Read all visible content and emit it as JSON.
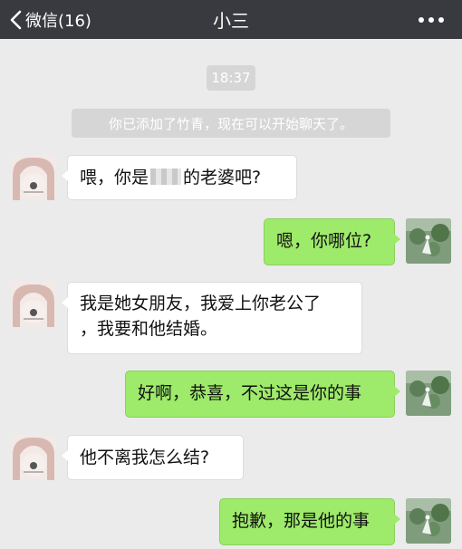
{
  "nav": {
    "back_label": "微信(16)",
    "title": "小三"
  },
  "chat": {
    "time": "18:37",
    "system_message": "你已添加了竹青，现在可以开始聊天了。",
    "messages": [
      {
        "side": "left",
        "text_before": "喂，你是",
        "text_after": "的老婆吧?"
      },
      {
        "side": "right",
        "text": "嗯，你哪位?"
      },
      {
        "side": "left",
        "line1": "我是她女朋友，我爱上你老公了",
        "line2": "，我要和他结婚。"
      },
      {
        "side": "right",
        "text": "好啊，恭喜，不过这是你的事"
      },
      {
        "side": "left",
        "text": "他不离我怎么结?"
      },
      {
        "side": "right",
        "text": "抱歉，那是他的事"
      }
    ]
  },
  "colors": {
    "nav_bg": "#393a3f",
    "chat_bg": "#ebebeb",
    "sent_bubble": "#9eea6a",
    "received_bubble": "#ffffff"
  },
  "icons": {
    "back": "chevron-left-icon",
    "more": "more-icon"
  }
}
